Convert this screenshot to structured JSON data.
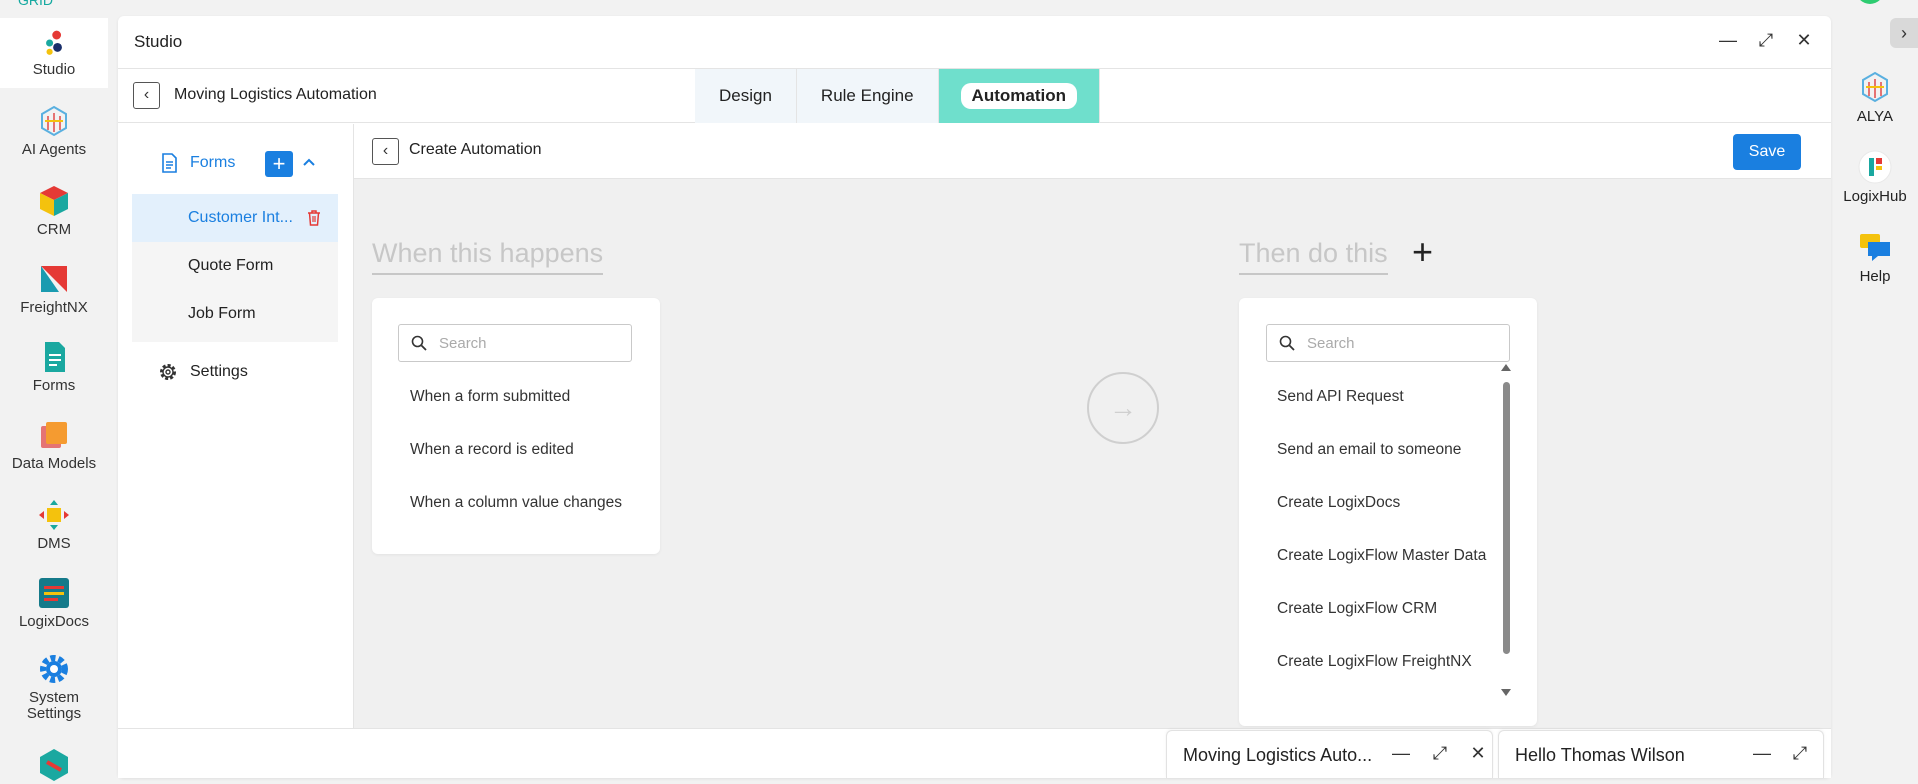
{
  "rail": {
    "top_text": "GRID",
    "items": [
      {
        "label": "Studio"
      },
      {
        "label": "AI Agents"
      },
      {
        "label": "CRM"
      },
      {
        "label": "FreightNX"
      },
      {
        "label": "Forms"
      },
      {
        "label": "Data Models"
      },
      {
        "label": "DMS"
      },
      {
        "label": "LogixDocs"
      },
      {
        "label": "System Settings"
      }
    ]
  },
  "right_rail": {
    "items": [
      {
        "label": "ALYA"
      },
      {
        "label": "LogixHub"
      },
      {
        "label": "Help"
      }
    ],
    "collapse_glyph": "›"
  },
  "window": {
    "title": "Studio",
    "project_name": "Moving Logistics Automation",
    "tabs": [
      {
        "label": "Design"
      },
      {
        "label": "Rule Engine"
      },
      {
        "label": "Automation"
      }
    ],
    "active_tab": "Automation"
  },
  "sidebar": {
    "forms_label": "Forms",
    "add_glyph": "+",
    "form_items": [
      {
        "label": "Customer Int..."
      },
      {
        "label": "Quote Form"
      },
      {
        "label": "Job Form"
      }
    ],
    "settings_label": "Settings"
  },
  "main": {
    "title": "Create Automation",
    "save_label": "Save",
    "trigger_section": {
      "title": "When this happens",
      "search_placeholder": "Search",
      "options": [
        "When a form submitted",
        "When a record is edited",
        "When a column value changes"
      ]
    },
    "action_section": {
      "title": "Then do this",
      "add_glyph": "+",
      "search_placeholder": "Search",
      "options": [
        "Send API Request",
        "Send an email to someone",
        "Create LogixDocs",
        "Create LogixFlow Master Data",
        "Create LogixFlow CRM",
        "Create LogixFlow FreightNX"
      ]
    },
    "arrow_glyph": "→"
  },
  "docked": [
    {
      "title": "Moving Logistics Auto..."
    },
    {
      "title": "Hello Thomas Wilson"
    }
  ],
  "colors": {
    "accent": "#1a7fe0",
    "active_tab": "#6fdfcc",
    "danger": "#e53935"
  }
}
